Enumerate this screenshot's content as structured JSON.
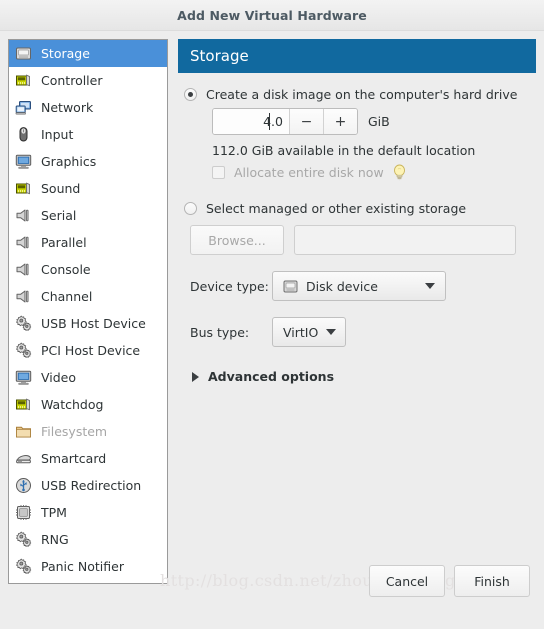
{
  "window": {
    "title": "Add New Virtual Hardware"
  },
  "sidebar": {
    "items": [
      {
        "label": "Storage",
        "icon": "storage-icon",
        "selected": true,
        "disabled": false
      },
      {
        "label": "Controller",
        "icon": "controller-card-icon",
        "selected": false,
        "disabled": false
      },
      {
        "label": "Network",
        "icon": "network-icon",
        "selected": false,
        "disabled": false
      },
      {
        "label": "Input",
        "icon": "mouse-icon",
        "selected": false,
        "disabled": false
      },
      {
        "label": "Graphics",
        "icon": "monitor-icon",
        "selected": false,
        "disabled": false
      },
      {
        "label": "Sound",
        "icon": "sound-card-icon",
        "selected": false,
        "disabled": false
      },
      {
        "label": "Serial",
        "icon": "serial-port-icon",
        "selected": false,
        "disabled": false
      },
      {
        "label": "Parallel",
        "icon": "serial-port-icon",
        "selected": false,
        "disabled": false
      },
      {
        "label": "Console",
        "icon": "serial-port-icon",
        "selected": false,
        "disabled": false
      },
      {
        "label": "Channel",
        "icon": "serial-port-icon",
        "selected": false,
        "disabled": false
      },
      {
        "label": "USB Host Device",
        "icon": "chip-gear-icon",
        "selected": false,
        "disabled": false
      },
      {
        "label": "PCI Host Device",
        "icon": "chip-gear-icon",
        "selected": false,
        "disabled": false
      },
      {
        "label": "Video",
        "icon": "monitor-icon",
        "selected": false,
        "disabled": false
      },
      {
        "label": "Watchdog",
        "icon": "controller-card-icon",
        "selected": false,
        "disabled": false
      },
      {
        "label": "Filesystem",
        "icon": "folder-icon",
        "selected": false,
        "disabled": true
      },
      {
        "label": "Smartcard",
        "icon": "smartcard-icon",
        "selected": false,
        "disabled": false
      },
      {
        "label": "USB Redirection",
        "icon": "usb-icon",
        "selected": false,
        "disabled": false
      },
      {
        "label": "TPM",
        "icon": "tpm-chip-icon",
        "selected": false,
        "disabled": false
      },
      {
        "label": "RNG",
        "icon": "chip-gear-icon",
        "selected": false,
        "disabled": false
      },
      {
        "label": "Panic Notifier",
        "icon": "chip-gear-icon",
        "selected": false,
        "disabled": false
      }
    ]
  },
  "panel": {
    "header_title": "Storage",
    "header_color": "#11699f",
    "selection_color": "#4a90d9",
    "create_image": {
      "radio_label": "Create a disk image on the computer's hard drive",
      "selected": true,
      "size_value": "4.0",
      "decrement_label": "−",
      "increment_label": "+",
      "unit": "GiB",
      "available_text": "112.0 GiB available in the default location",
      "allocate_label": "Allocate entire disk now",
      "allocate_checked": false,
      "allocate_disabled": true,
      "tip_icon": "lightbulb-icon"
    },
    "existing_storage": {
      "radio_label": "Select managed or other existing storage",
      "selected": false,
      "browse_label": "Browse...",
      "browse_disabled": true,
      "path_value": "",
      "path_disabled": true
    },
    "device_type": {
      "label": "Device type:",
      "value": "Disk device",
      "icon": "disk-icon"
    },
    "bus_type": {
      "label": "Bus type:",
      "value": "VirtIO"
    },
    "advanced": {
      "label": "Advanced options",
      "expanded": false
    }
  },
  "footer": {
    "watermark": "http://blog.csdn.net/zhouhengyang1993",
    "cancel_label": "Cancel",
    "finish_label": "Finish"
  }
}
